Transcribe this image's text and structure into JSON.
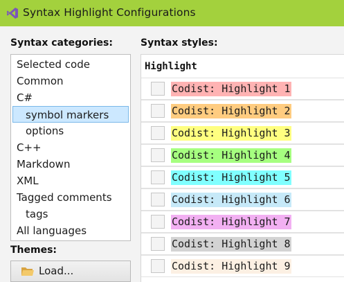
{
  "window": {
    "title": "Syntax Highlight Configurations"
  },
  "categories": {
    "heading": "Syntax categories:",
    "items": [
      {
        "label": "Selected code",
        "level": 0,
        "selected": false
      },
      {
        "label": "Common",
        "level": 0,
        "selected": false
      },
      {
        "label": "C#",
        "level": 0,
        "selected": false
      },
      {
        "label": "symbol markers",
        "level": 1,
        "selected": true
      },
      {
        "label": "options",
        "level": 1,
        "selected": false
      },
      {
        "label": "C++",
        "level": 0,
        "selected": false
      },
      {
        "label": "Markdown",
        "level": 0,
        "selected": false
      },
      {
        "label": "XML",
        "level": 0,
        "selected": false
      },
      {
        "label": "Tagged comments",
        "level": 0,
        "selected": false
      },
      {
        "label": "tags",
        "level": 1,
        "selected": false
      },
      {
        "label": "All languages",
        "level": 0,
        "selected": false
      }
    ]
  },
  "themes": {
    "heading": "Themes:",
    "load_label": "Load..."
  },
  "styles": {
    "heading": "Syntax styles:",
    "group": "Highlight",
    "rows": [
      {
        "label": "Codist: Highlight 1",
        "color": "#ffb3b3",
        "checked": false
      },
      {
        "label": "Codist: Highlight 2",
        "color": "#ffcc80",
        "checked": false
      },
      {
        "label": "Codist: Highlight 3",
        "color": "#ffff80",
        "checked": false
      },
      {
        "label": "Codist: Highlight 4",
        "color": "#a6ff80",
        "checked": false
      },
      {
        "label": "Codist: Highlight 5",
        "color": "#80ffff",
        "checked": false
      },
      {
        "label": "Codist: Highlight 6",
        "color": "#c6e9f8",
        "checked": false
      },
      {
        "label": "Codist: Highlight 7",
        "color": "#f2b0f2",
        "checked": false
      },
      {
        "label": "Codist: Highlight 8",
        "color": "#d3d3d3",
        "checked": false
      },
      {
        "label": "Codist: Highlight 9",
        "color": "#fcf0e3",
        "checked": false
      }
    ]
  },
  "icons": {
    "app": "visual-studio-icon",
    "load": "folder-icon"
  }
}
